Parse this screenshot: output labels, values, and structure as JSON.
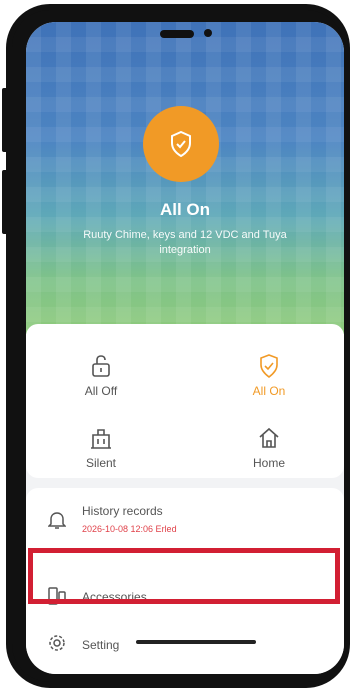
{
  "hero": {
    "title": "All On",
    "subtitle": "Ruuty Chime, keys and 12 VDC and Tuya integration"
  },
  "modes": [
    {
      "label": "All Off",
      "icon": "lock-open-icon",
      "active": false
    },
    {
      "label": "All On",
      "icon": "shield-check-icon",
      "active": true
    },
    {
      "label": "Silent",
      "icon": "building-icon",
      "active": false
    },
    {
      "label": "Home",
      "icon": "home-icon",
      "active": false
    }
  ],
  "menu": {
    "history": {
      "label": "History records",
      "timestamp": "2026-10-08 12:06 Erled",
      "icon": "bell-icon"
    },
    "accessories": {
      "label": "Accessories",
      "icon": "accessories-icon"
    },
    "setting": {
      "label": "Setting",
      "icon": "gear-icon"
    }
  },
  "colors": {
    "accent": "#f19a26",
    "highlight_box": "#d21f33",
    "alert_text": "#e0424a"
  }
}
